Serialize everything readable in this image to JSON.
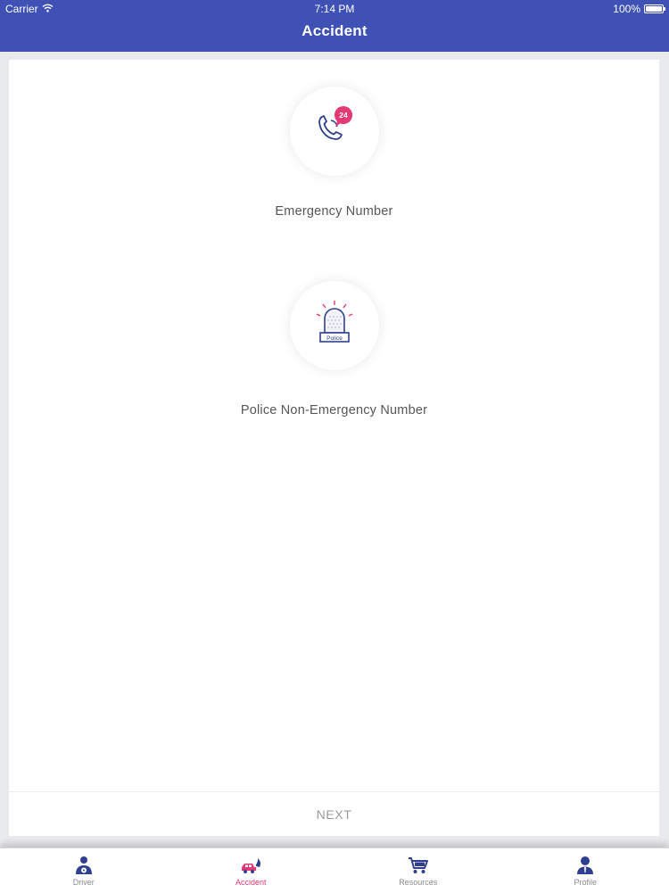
{
  "status_bar": {
    "carrier": "Carrier",
    "time": "7:14 PM",
    "battery": "100%",
    "battery_level": 1.0
  },
  "nav": {
    "title": "Accident"
  },
  "options": [
    {
      "label": "Emergency Number",
      "icon": "phone-24-icon",
      "badge": "24"
    },
    {
      "label": "Police Non-Emergency Number",
      "icon": "police-siren-icon",
      "badge": "Police"
    }
  ],
  "next_label": "NEXT",
  "tabs": [
    {
      "label": "Driver",
      "icon": "driver-icon",
      "active": false
    },
    {
      "label": "Accident",
      "icon": "car-crash-icon",
      "active": true
    },
    {
      "label": "Resources",
      "icon": "cart-icon",
      "active": false
    },
    {
      "label": "Profile",
      "icon": "profile-icon",
      "active": false
    }
  ],
  "colors": {
    "header": "#3f51b5",
    "accent": "#e53974",
    "icon_dark": "#2f3f8f",
    "text": "#565656"
  }
}
